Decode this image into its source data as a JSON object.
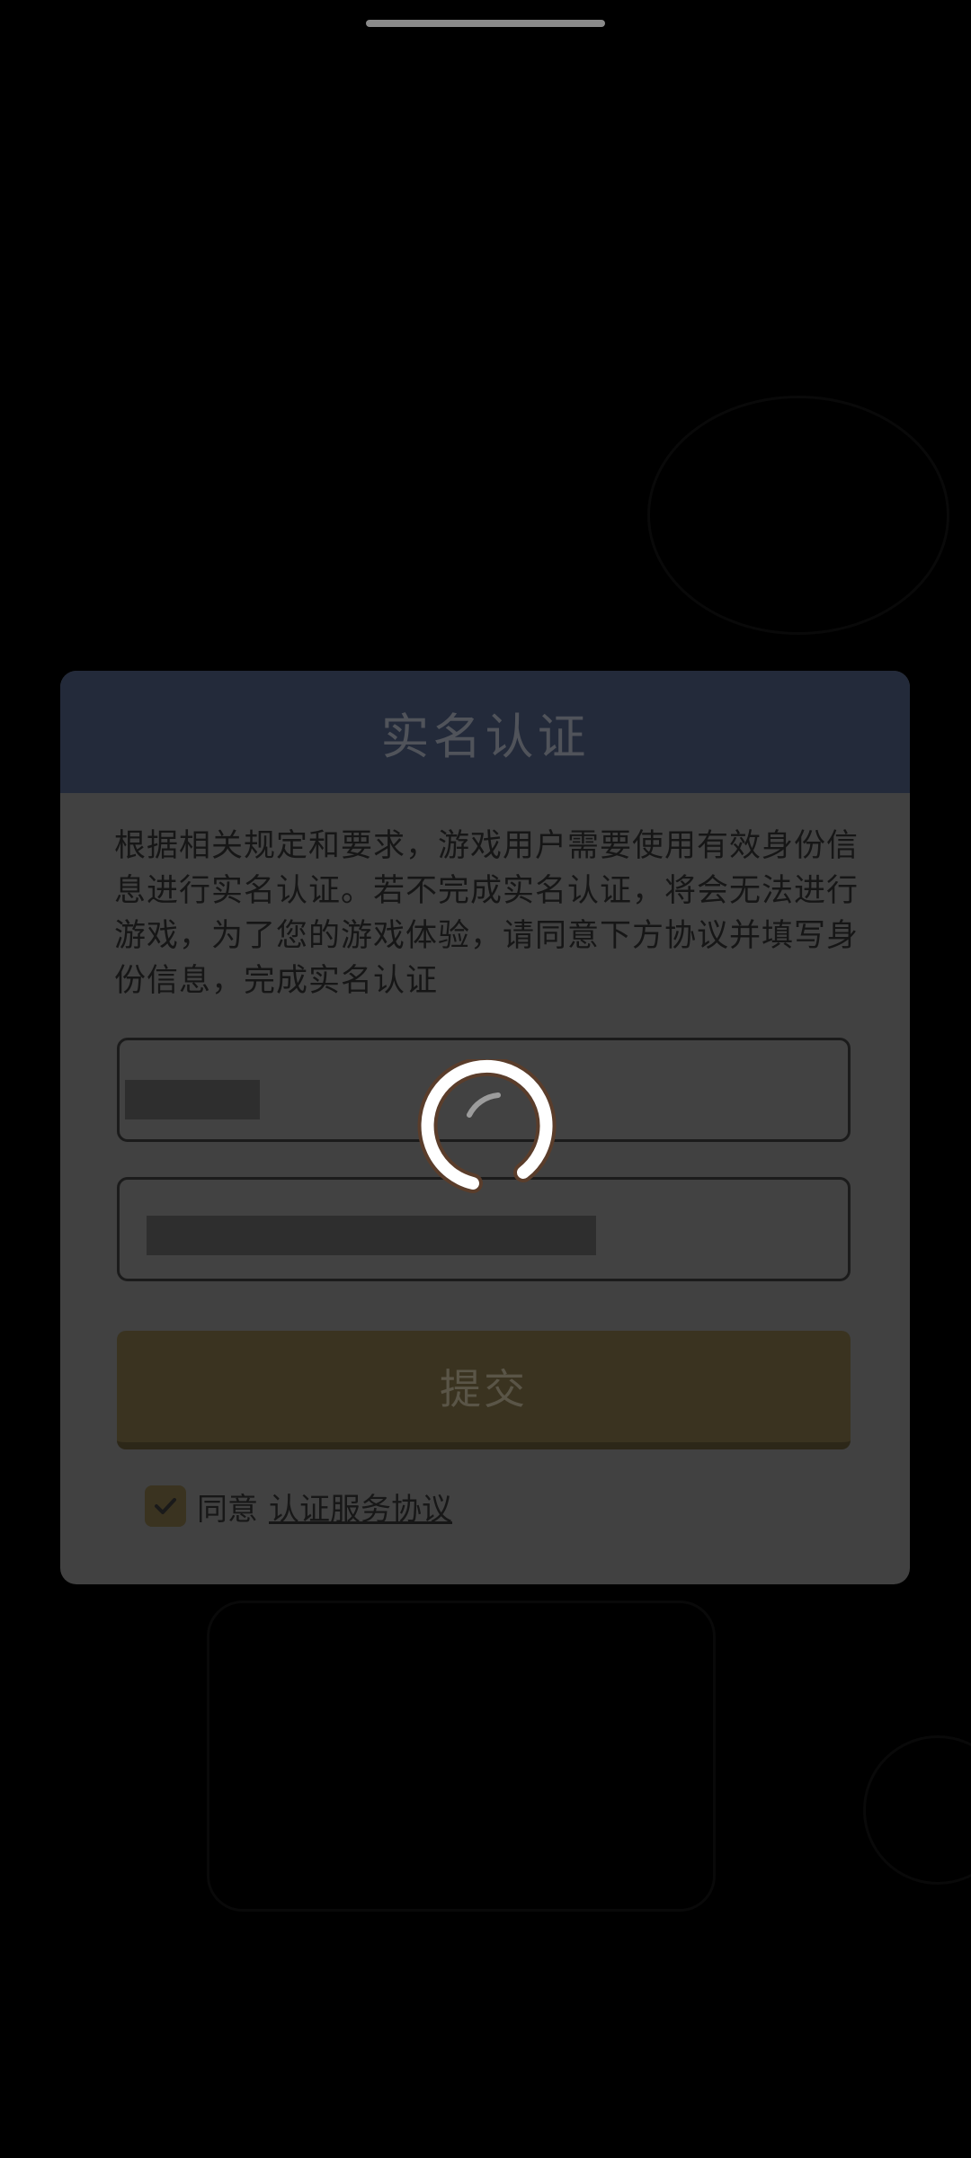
{
  "dialog": {
    "title": "实名认证",
    "notice": "根据相关规定和要求，游戏用户需要使用有效身份信息进行实名认证。若不完成实名认证，将会无法进行游戏，为了您的游戏体验，请同意下方协议并填写身份信息，完成实名认证",
    "submit_label": "提交",
    "agree_label": "同意",
    "agreement_link": "认证服务协议",
    "agree_checked": true
  },
  "colors": {
    "header": "#232a3a",
    "panel": "#414141",
    "accent": "#3a3320"
  },
  "icons": {
    "spinner": "loading-spinner-icon",
    "check": "checkmark-icon"
  }
}
